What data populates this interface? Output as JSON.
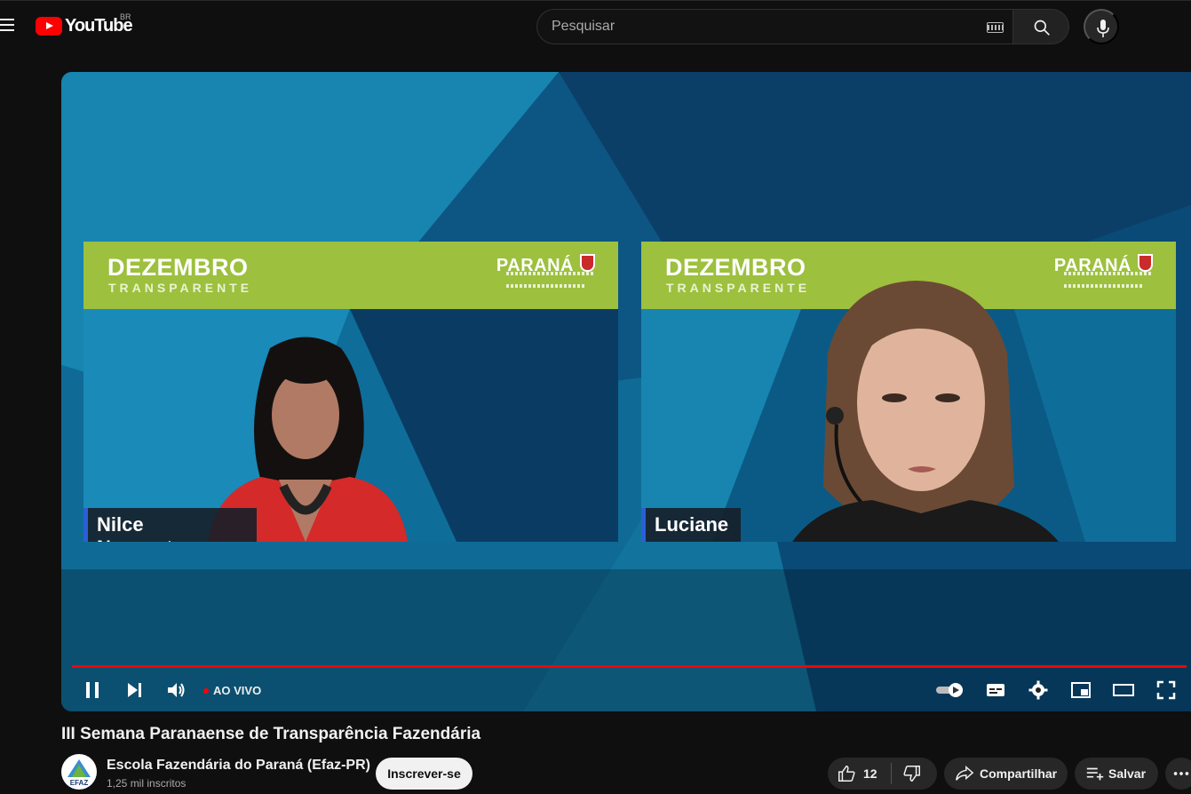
{
  "masthead": {
    "logo_text": "YouTube",
    "country_code": "BR",
    "search_placeholder": "Pesquisar"
  },
  "player": {
    "panels": [
      {
        "banner_title": "DEZEMBRO",
        "banner_subtitle": "TRANSPARENTE",
        "brand": "PARANÁ",
        "speaker": "Nilce Nascentes"
      },
      {
        "banner_title": "DEZEMBRO",
        "banner_subtitle": "TRANSPARENTE",
        "brand": "PARANÁ",
        "speaker": "Luciane"
      }
    ],
    "live_label": "AO VIVO",
    "progress_fraction": 1.0,
    "colors": {
      "progress": "#ff0000",
      "banner": "#9dc03e",
      "name_tag_accent": "#2a5fd6"
    }
  },
  "video": {
    "title": "III Semana Paranaense de Transparência Fazendária",
    "channel_name": "Escola Fazendária do Paraná (Efaz-PR)",
    "avatar_text": "EFAZ",
    "subscribers": "1,25 mil inscritos",
    "subscribe_label": "Inscrever-se",
    "likes": "12",
    "share_label": "Compartilhar",
    "save_label": "Salvar"
  },
  "icons": [
    "menu-icon",
    "youtube-logo-icon",
    "keyboard-icon",
    "search-icon",
    "mic-icon",
    "pause-icon",
    "next-icon",
    "volume-icon",
    "autoplay-toggle-icon",
    "subtitles-icon",
    "settings-icon",
    "miniplayer-icon",
    "theater-icon",
    "fullscreen-icon",
    "like-icon",
    "dislike-icon",
    "share-icon",
    "save-icon",
    "more-icon"
  ]
}
